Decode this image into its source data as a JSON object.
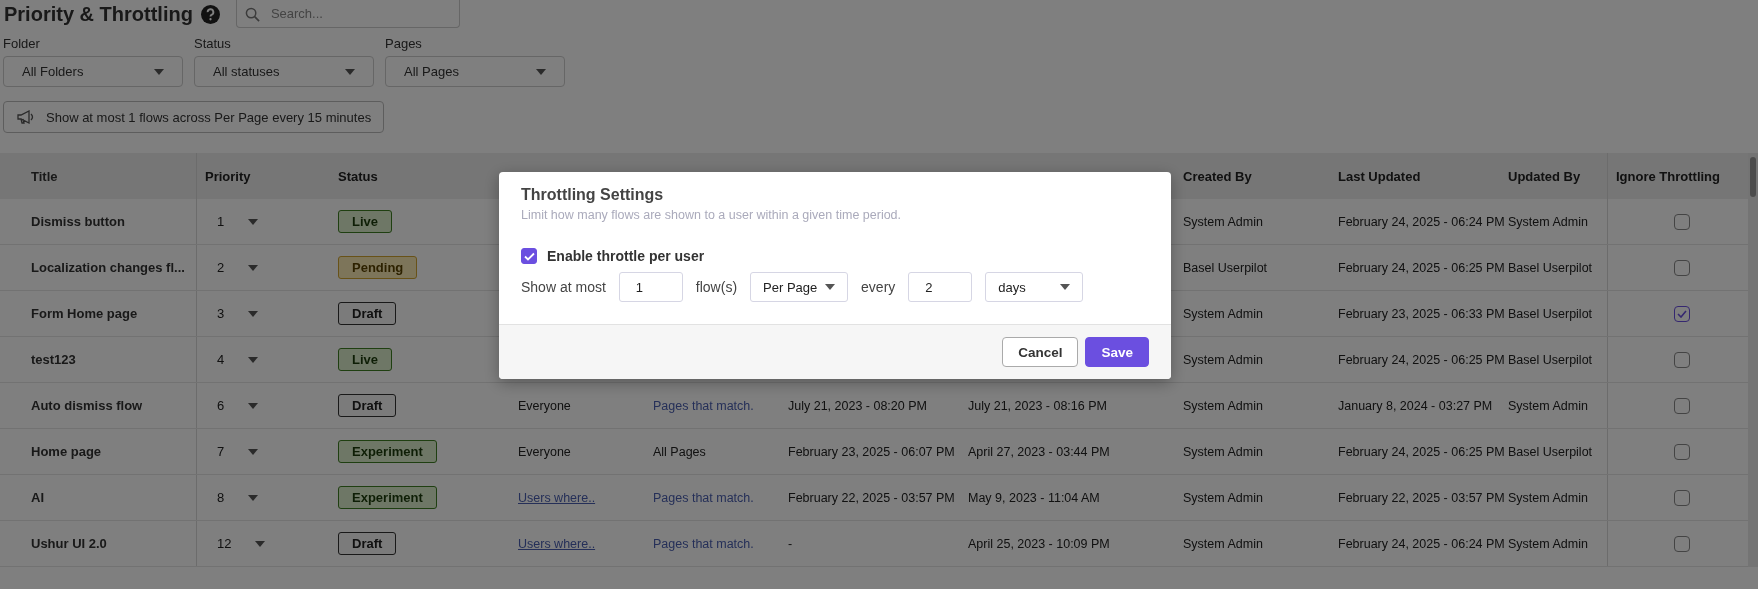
{
  "header": {
    "title": "Priority & Throttling",
    "search": {
      "placeholder": "Search..."
    }
  },
  "filters": [
    {
      "label": "Folder",
      "value": "All Folders"
    },
    {
      "label": "Status",
      "value": "All statuses"
    },
    {
      "label": "Pages",
      "value": "All Pages"
    }
  ],
  "throttle_summary": "Show at most 1 flows across Per Page every 15 minutes",
  "table": {
    "columns": {
      "title": "Title",
      "priority": "Priority",
      "status": "Status",
      "created_by": "Created By",
      "last_updated": "Last Updated",
      "updated_by": "Updated By",
      "ignore_throttling": "Ignore Throttling"
    },
    "rows": [
      {
        "title": "Dismiss button",
        "priority": "1",
        "status": {
          "label": "Live",
          "kind": "live"
        },
        "created_by": "System Admin",
        "last_updated": "February 24, 2025 - 06:24 PM",
        "updated_by": "System Admin",
        "ignore_throttling": false
      },
      {
        "title": "Localization changes fl...",
        "priority": "2",
        "status": {
          "label": "Pending",
          "kind": "pending"
        },
        "created_by": "Basel Userpilot",
        "last_updated": "February 24, 2025 - 06:25 PM",
        "updated_by": "Basel Userpilot",
        "ignore_throttling": false
      },
      {
        "title": "Form Home page",
        "priority": "3",
        "status": {
          "label": "Draft",
          "kind": "draft"
        },
        "created_by": "System Admin",
        "last_updated": "February 23, 2025 - 06:33 PM",
        "updated_by": "Basel Userpilot",
        "ignore_throttling": true
      },
      {
        "title": "test123",
        "priority": "4",
        "status": {
          "label": "Live",
          "kind": "live"
        },
        "created_by": "System Admin",
        "last_updated": "February 24, 2025 - 06:25 PM",
        "updated_by": "Basel Userpilot",
        "ignore_throttling": false
      },
      {
        "title": "Auto dismiss flow",
        "priority": "6",
        "status": {
          "label": "Draft",
          "kind": "draft"
        },
        "target_users": {
          "text": "Everyone",
          "link": false
        },
        "target_pages": {
          "text": "Pages that match.",
          "link": true
        },
        "published": "July 21, 2023 - 08:20 PM",
        "created": "July 21, 2023 - 08:16 PM",
        "created_by": "System Admin",
        "last_updated": "January 8, 2024 - 03:27 PM",
        "updated_by": "System Admin",
        "ignore_throttling": false
      },
      {
        "title": "Home page",
        "priority": "7",
        "status": {
          "label": "Experiment",
          "kind": "experiment"
        },
        "target_users": {
          "text": "Everyone",
          "link": false
        },
        "target_pages": {
          "text": "All Pages",
          "link": false
        },
        "published": "February 23, 2025 - 06:07 PM",
        "created": "April 27, 2023 - 03:44 PM",
        "created_by": "System Admin",
        "last_updated": "February 24, 2025 - 06:25 PM",
        "updated_by": "Basel Userpilot",
        "ignore_throttling": false
      },
      {
        "title": "AI",
        "priority": "8",
        "status": {
          "label": "Experiment",
          "kind": "experiment"
        },
        "target_users": {
          "text": "Users where..",
          "link": true
        },
        "target_pages": {
          "text": "Pages that match.",
          "link": true
        },
        "published": "February 22, 2025 - 03:57 PM",
        "created": "May 9, 2023 - 11:04 AM",
        "created_by": "System Admin",
        "last_updated": "February 22, 2025 - 03:57 PM",
        "updated_by": "System Admin",
        "ignore_throttling": false
      },
      {
        "title": "Ushur UI 2.0",
        "priority": "12",
        "status": {
          "label": "Draft",
          "kind": "draft"
        },
        "target_users": {
          "text": "Users where..",
          "link": true
        },
        "target_pages": {
          "text": "Pages that match.",
          "link": true
        },
        "published": "-",
        "created": "April 25, 2023 - 10:09 PM",
        "created_by": "System Admin",
        "last_updated": "February 24, 2025 - 06:24 PM",
        "updated_by": "System Admin",
        "ignore_throttling": false
      }
    ]
  },
  "modal": {
    "title": "Throttling Settings",
    "subtitle": "Limit how many flows are shown to a user within a given time period.",
    "enable": {
      "label": "Enable throttle per user",
      "checked": true
    },
    "show_at_most_label": "Show at most",
    "count": "1",
    "flows_label": "flow(s)",
    "scope": "Per Page",
    "every_label": "every",
    "interval": "2",
    "unit": "days",
    "buttons": [
      {
        "label": "Cancel",
        "kind": "secondary"
      },
      {
        "label": "Save",
        "kind": "primary"
      }
    ]
  }
}
